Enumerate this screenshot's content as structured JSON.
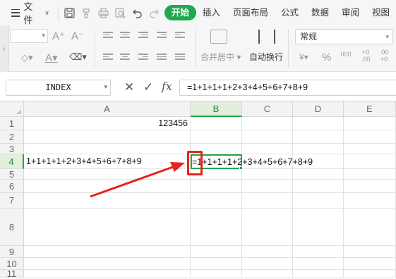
{
  "menubar": {
    "file_label": "文件",
    "tabs": [
      {
        "label": "开始",
        "active": true
      },
      {
        "label": "插入",
        "active": false
      },
      {
        "label": "页面布局",
        "active": false
      },
      {
        "label": "公式",
        "active": false
      },
      {
        "label": "数据",
        "active": false
      },
      {
        "label": "审阅",
        "active": false
      },
      {
        "label": "视图",
        "active": false
      }
    ],
    "quick_access_icons": [
      "save-icon",
      "format-painter-icon",
      "print-icon",
      "print-preview-icon",
      "undo-icon",
      "redo-icon"
    ]
  },
  "ribbon": {
    "merge_center_label": "合并居中",
    "wrap_text_label": "自动换行",
    "number_format": "常规",
    "increase_font_glyph": "A⁺",
    "decrease_font_glyph": "A⁻",
    "currency_glyph": "¥",
    "percent_glyph": "%",
    "thousands_glyph": "000",
    "increase_decimal_glyph": "+0 .00",
    "decrease_decimal_glyph": ".00 +0"
  },
  "formula_bar": {
    "name_box": "INDEX",
    "fx_label": "fx",
    "content": "=1+1+1+1+2+3+4+5+6+7+8+9"
  },
  "grid": {
    "columns": [
      "A",
      "B",
      "C",
      "D",
      "E"
    ],
    "rows": [
      "1",
      "2",
      "3",
      "4",
      "5",
      "6",
      "7",
      "8",
      "9",
      "10",
      "11"
    ],
    "cells": {
      "A1": "123456",
      "A4": "1+1+1+1+2+3+4+5+6+7+8+9",
      "B4": "=1+1+1+1+2+3+4+5+6+7+8+9"
    },
    "active_cell": "B4"
  },
  "colors": {
    "accent": "#1fa94c",
    "annotation": "#e8221b"
  }
}
